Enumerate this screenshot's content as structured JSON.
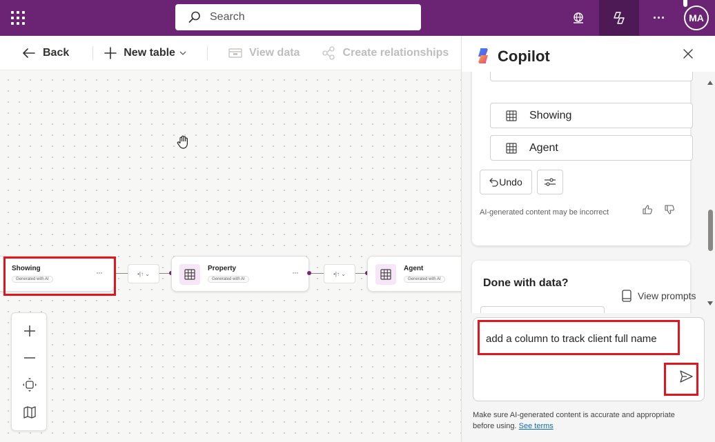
{
  "topbar": {
    "search_placeholder": "Search",
    "avatar_initials": "MA",
    "more_label": "···"
  },
  "commandbar": {
    "back_label": "Back",
    "new_table_label": "New table",
    "view_data_label": "View data",
    "create_relationships_label": "Create relationships"
  },
  "canvas": {
    "nodes": [
      {
        "title": "Showing",
        "badge": "Generated with AI"
      },
      {
        "title": "Property",
        "badge": "Generated with AI"
      },
      {
        "title": "Agent",
        "badge": "Generated with AI"
      }
    ],
    "more": "···",
    "rel_label": "•|↑ ⌄"
  },
  "copilot": {
    "title": "Copilot",
    "tables": [
      "Showing",
      "Agent"
    ],
    "undo_label": "Undo",
    "ai_note": "AI-generated content may be incorrect",
    "done_title": "Done with data?",
    "view_prompts_label": "View prompts",
    "input_text": "add a column to track client full name",
    "disclaimer_text": "Make sure AI-generated content is accurate and appropriate before using.",
    "see_terms_label": "See terms"
  }
}
